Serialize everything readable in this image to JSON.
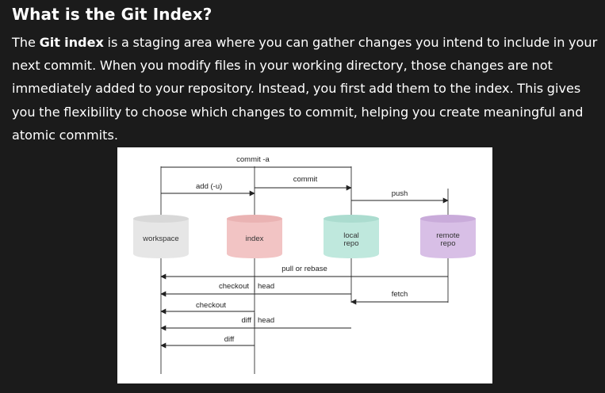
{
  "heading": "What is the Git Index?",
  "paragraph": {
    "prefix": "The ",
    "bold_term": "Git index",
    "rest": " is a staging area where you can gather changes you intend to include in your next commit. When you modify files in your working directory, those changes are not immediately added to your repository. Instead, you first add them to the index. This gives you the flexibility to choose which changes to commit, helping you create meaningful and atomic commits."
  },
  "diagram": {
    "stores": {
      "workspace": {
        "label": "workspace",
        "color": "#e6e6e6"
      },
      "index": {
        "label": "index",
        "color": "#f2c4c4"
      },
      "local": {
        "label_line1": "local",
        "label_line2": "repo",
        "color": "#bfe8dd"
      },
      "remote": {
        "label_line1": "remote",
        "label_line2": "repo",
        "color": "#d8bfe6"
      }
    },
    "labels": {
      "commit_a": "commit -a",
      "add_u": "add (-u)",
      "commit": "commit",
      "push": "push",
      "pull_or_rebase": "pull or rebase",
      "checkout_head_left": "checkout",
      "checkout_head_right": "head",
      "fetch": "fetch",
      "checkout": "checkout",
      "diff_head_left": "diff",
      "diff_head_right": "head",
      "diff": "diff"
    }
  }
}
